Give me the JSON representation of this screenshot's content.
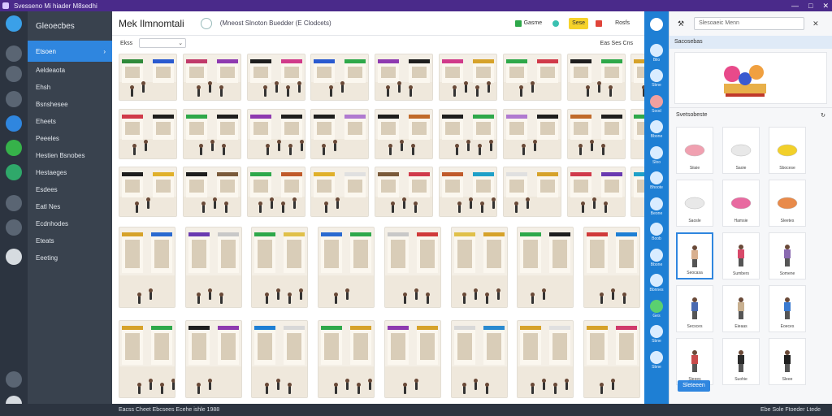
{
  "window": {
    "title": "Svesseno Mi hiader M8sedhi",
    "controls": [
      "—",
      "□",
      "✕"
    ]
  },
  "rail": {
    "icons": [
      {
        "name": "app-logo-icon",
        "color": "#3aa0e8"
      },
      {
        "name": "grid-icon",
        "color": "#5a6573"
      },
      {
        "name": "chart-icon",
        "color": "#5a6573"
      },
      {
        "name": "camera-icon",
        "color": "#5a6573"
      },
      {
        "name": "eye-icon",
        "color": "#2f86df"
      },
      {
        "name": "leaf-icon",
        "color": "#36b24a"
      },
      {
        "name": "globe-icon",
        "color": "#2fa86a"
      },
      {
        "name": "tools-icon",
        "color": "#5a6573"
      },
      {
        "name": "user-icon",
        "color": "#5a6573"
      },
      {
        "name": "cloud-icon",
        "color": "#d6dbe0"
      },
      {
        "name": "clock-icon",
        "color": "#5a6573"
      },
      {
        "name": "account-icon",
        "color": "#d6dbe0"
      }
    ]
  },
  "sidebar": {
    "brand": "Gleoecbes",
    "active_item": {
      "label": "Etsoen",
      "chevron": "›"
    },
    "items": [
      {
        "label": "Aeldeaota"
      },
      {
        "label": "Ehsh"
      },
      {
        "label": "Bsnshesee"
      },
      {
        "label": "Eheets"
      },
      {
        "label": "Peeeles"
      },
      {
        "label": "Hestien Bsnobes"
      },
      {
        "label": "Hestaeges"
      },
      {
        "label": "Esdees"
      },
      {
        "label": "Eatl Nes"
      },
      {
        "label": "Ecdnhodes"
      },
      {
        "label": "Eteats"
      },
      {
        "label": "Eeeting"
      }
    ]
  },
  "main": {
    "title": "Mek Ilmnomtali",
    "subtitle": "(Mneost Slnoton Buedder (E Clodcets)",
    "badges": [
      {
        "label": "Gasme",
        "icon": "green-square-icon",
        "bg": "#ffffff",
        "color": "#333",
        "accent": "#2ea84a"
      },
      {
        "label": "",
        "icon": "teal-dot-icon",
        "bg": "#ffffff",
        "color": "#333",
        "accent": "#3ac0b0"
      },
      {
        "label": "Sese",
        "icon": "",
        "bg": "#f6d22a",
        "color": "#333",
        "accent": "#f6d22a"
      },
      {
        "label": "",
        "icon": "red-square-icon",
        "bg": "#ffffff",
        "color": "#333",
        "accent": "#e0443a"
      },
      {
        "label": "Rosfs",
        "icon": "",
        "bg": "#ffffff",
        "color": "#333",
        "accent": "#333"
      }
    ],
    "filter_label": "Ekss",
    "dropdown_value": "⌄",
    "filter_right": "Eas Ses Cns",
    "tile_colors": [
      "#2f8a3a",
      "#c03a6a",
      "#1e1e1e",
      "#2a5ad0",
      "#8e3ab0",
      "#d03a8a",
      "#2ea84a",
      "#1e1e1e",
      "#d6a22a",
      "#d03a4a",
      "#2ea84a",
      "#8e3ab0",
      "#1e1e1e",
      "#1e1e1e",
      "#1e1e1e",
      "#b07ad0",
      "#c06a2a",
      "#2ea84a",
      "#1e1e1e",
      "#1e1e1e",
      "#2ea84a",
      "#e0b02a",
      "#7a5a3a",
      "#c05a2a",
      "#e0e0e0",
      "#d03a4a",
      "#1ea0c8",
      "#d6a22a",
      "#6a3ab0",
      "#2ea84a",
      "#2a6ad0",
      "#c8c8c8",
      "#e0c04a",
      "#2ea84a",
      "#d03a3a",
      "#d6a22a",
      "#1e1e1e",
      "#1e7fd4",
      "#2ea84a",
      "#8e3ab0",
      "#d8d8d8",
      "#d6a22a",
      "#d6a22a",
      "#2a8ad0",
      "#e0e0e0",
      "#d03a6a"
    ]
  },
  "strip": {
    "items": [
      {
        "label": "",
        "icon": "circle-logo-icon",
        "color": "#ffffff"
      },
      {
        "label": "Bilo",
        "icon": "box-icon",
        "color": "#d9ecff"
      },
      {
        "label": "Sbne",
        "icon": "window-icon",
        "color": "#d9ecff"
      },
      {
        "label": "Sood",
        "icon": "record-icon",
        "color": "#f0a0a0"
      },
      {
        "label": "Bbone",
        "icon": "layers-icon",
        "color": "#d9ecff"
      },
      {
        "label": "Sloo",
        "icon": "bolt-icon",
        "color": "#d9ecff"
      },
      {
        "label": "Bhoote",
        "icon": "cube-icon",
        "color": "#d9ecff"
      },
      {
        "label": "Beone",
        "icon": "sphere-icon",
        "color": "#d9ecff"
      },
      {
        "label": "Boob",
        "icon": "grid-icon",
        "color": "#d9ecff"
      },
      {
        "label": "Bbone",
        "icon": "bubble-icon",
        "color": "#d9ecff"
      },
      {
        "label": "Bbnnes",
        "icon": "table-icon",
        "color": "#d9ecff"
      },
      {
        "label": "Ges",
        "icon": "leaf-icon",
        "color": "#5ad070"
      },
      {
        "label": "Sbne",
        "icon": "chat-icon",
        "color": "#d9ecff"
      },
      {
        "label": "Sbne",
        "icon": "doc-icon",
        "color": "#d9ecff"
      }
    ]
  },
  "panel": {
    "search_placeholder": "Slesoaeic Menn",
    "section_title": "Sacosebas",
    "section2_title": "Svetsobeste",
    "refresh_symbol": "↻",
    "assets": [
      {
        "label": "Siiaie",
        "shape": "fish-icon",
        "color": "#f0a0b0",
        "selected": false
      },
      {
        "label": "Saoie",
        "shape": "bird-icon",
        "color": "#e8e8e8",
        "selected": false
      },
      {
        "label": "Sbocese",
        "shape": "shoe-icon",
        "color": "#f2d02a",
        "selected": false
      },
      {
        "label": "Saosle",
        "shape": "bean-icon",
        "color": "#e8e8e8",
        "selected": false
      },
      {
        "label": "Hamsie",
        "shape": "slipper-icon",
        "color": "#e86aa0",
        "selected": false
      },
      {
        "label": "Sleetes",
        "shape": "bag-icon",
        "color": "#e88a4a",
        "selected": false
      },
      {
        "label": "Seocasa",
        "shape": "person-icon",
        "color": "#d8b090",
        "selected": true
      },
      {
        "label": "Sumbers",
        "shape": "person-icon",
        "color": "#d84a6a",
        "selected": false
      },
      {
        "label": "Somene",
        "shape": "person-icon",
        "color": "#8a6ab0",
        "selected": false
      },
      {
        "label": "Secsces",
        "shape": "person-icon",
        "color": "#4a6ab0",
        "selected": false
      },
      {
        "label": "Eieaas",
        "shape": "person-icon",
        "color": "#c8b090",
        "selected": false
      },
      {
        "label": "Eoeces",
        "shape": "person-icon",
        "color": "#3a7ad0",
        "selected": false
      },
      {
        "label": "Sieees",
        "shape": "person-icon",
        "color": "#c84a4a",
        "selected": false
      },
      {
        "label": "Suohie",
        "shape": "person-icon",
        "color": "#2a2a2a",
        "selected": false
      },
      {
        "label": "Sleee",
        "shape": "person-icon",
        "color": "#1e1e1e",
        "selected": false
      }
    ],
    "apply_label": "Sleteeen"
  },
  "status": {
    "left": "Eacss  Cheet  Ebcsees  Ecehe ishle 1988",
    "right": "Ebe Sole Ftoeder Ltede"
  }
}
